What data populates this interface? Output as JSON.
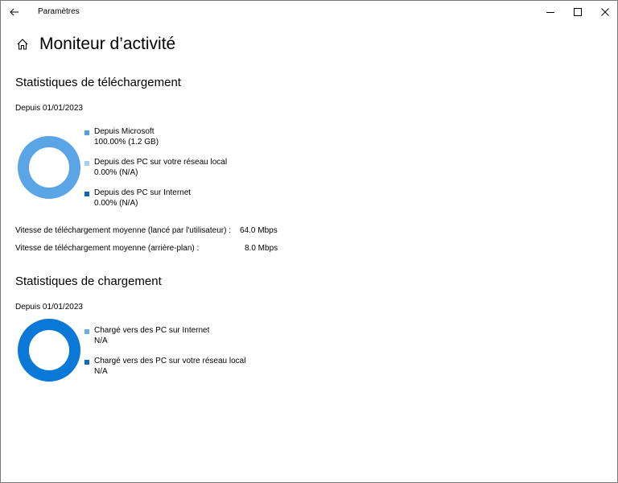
{
  "window": {
    "title": "Paramètres"
  },
  "page": {
    "title": "Moniteur d’activité"
  },
  "download": {
    "title": "Statistiques de téléchargement",
    "since": "Depuis 01/01/2023",
    "legend": [
      {
        "name": "Depuis Microsoft",
        "value": "100.00%  (1.2 GB)",
        "color": "#4f9fe3"
      },
      {
        "name": "Depuis des PC sur votre réseau local",
        "value": "0.00%  (N/A)",
        "color": "#a9cdf0"
      },
      {
        "name": "Depuis des PC sur Internet",
        "value": "0.00%  (N/A)",
        "color": "#0a63c2"
      }
    ],
    "chart": {
      "color": "#5aa5e6",
      "share": 100
    },
    "stats": [
      {
        "label": "Vitesse de téléchargement moyenne (lancé par l'utilisateur) :",
        "value": "64.0 Mbps"
      },
      {
        "label": "Vitesse de téléchargement moyenne (arrière-plan) :",
        "value": "8.0 Mbps"
      }
    ]
  },
  "upload": {
    "title": "Statistiques de chargement",
    "since": "Depuis 01/01/2023",
    "legend": [
      {
        "name": "Chargé vers des PC sur Internet",
        "value": "N/A",
        "color": "#69aee8"
      },
      {
        "name": "Chargé vers des PC sur votre réseau local",
        "value": "N/A",
        "color": "#0a6bd0"
      }
    ],
    "chart": {
      "color": "#0a78d7",
      "share": 100
    }
  },
  "icons": {
    "back": "arrow-left-icon",
    "home": "home-icon",
    "minimize": "minimize-icon",
    "maximize": "maximize-icon",
    "close": "close-icon"
  }
}
